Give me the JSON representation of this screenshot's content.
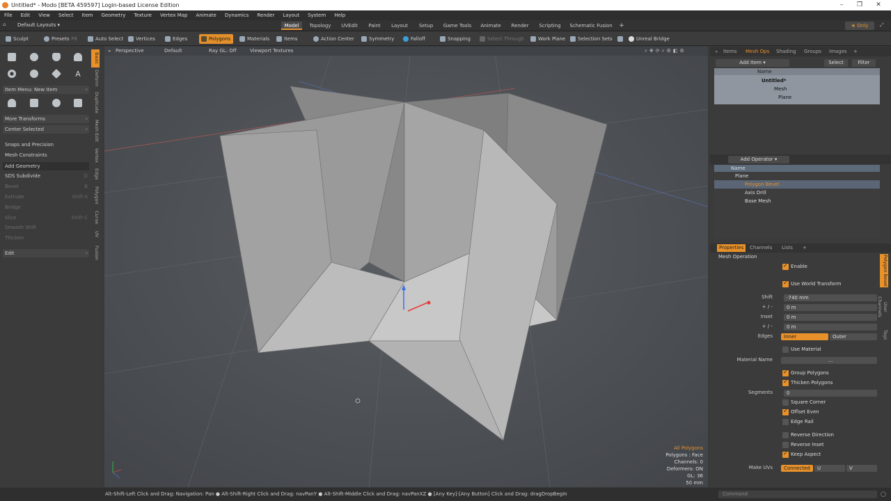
{
  "window": {
    "title": "Untitled* - Modo [BETA 459597] Login-based License Edition"
  },
  "menu": [
    "File",
    "Edit",
    "View",
    "Select",
    "Item",
    "Geometry",
    "Texture",
    "Vertex Map",
    "Animate",
    "Dynamics",
    "Render",
    "Layout",
    "System",
    "Help"
  ],
  "layout_bar": {
    "layout_name": "Default Layouts",
    "only_label": "Only",
    "tabs": [
      "Model",
      "Topology",
      "UVEdit",
      "Paint",
      "Layout",
      "Setup",
      "Game Tools",
      "Animate",
      "Render",
      "Scripting",
      "Schematic Fusion"
    ],
    "add": "+"
  },
  "toolbar": {
    "sculpt": "Sculpt",
    "presets": "Presets",
    "presets_key": "F6",
    "auto_select": "Auto Select",
    "vertices": "Vertices",
    "edges": "Edges",
    "polygons": "Polygons",
    "materials": "Materials",
    "items": "Items",
    "action_center": "Action Center",
    "symmetry": "Symmetry",
    "falloff": "Falloff",
    "snapping": "Snapping",
    "select_through": "Select Through",
    "work_plane": "Work Plane",
    "selection_sets": "Selection Sets",
    "unreal_bridge": "Unreal Bridge"
  },
  "left_panel": {
    "item_menu": "Item Menu: New Item",
    "more_transforms": "More Transforms",
    "center_selected": "Center Selected",
    "snaps": "Snaps and Precision",
    "mesh_constraints": "Mesh Constraints",
    "add_geometry": "Add Geometry",
    "tools": [
      {
        "label": "SDS Subdivide",
        "key": "D"
      },
      {
        "label": "Bevel",
        "key": "B"
      },
      {
        "label": "Extrude",
        "key": "Shift-X"
      },
      {
        "label": "Bridge",
        "key": ""
      },
      {
        "label": "Slice",
        "key": "Shift-C"
      },
      {
        "label": "Smooth Shift",
        "key": ""
      },
      {
        "label": "Thicken",
        "key": ""
      }
    ],
    "edit": "Edit",
    "vtabs": [
      "Basic",
      "Deform",
      "Duplicate",
      "Mesh Edit",
      "Vertex",
      "Edge",
      "Polygon",
      "Curve",
      "UV",
      "Fusion"
    ]
  },
  "viewport": {
    "perspective": "Perspective",
    "shading": "Default",
    "raygl": "Ray GL: Off",
    "textures": "Viewport Textures",
    "info": [
      "All Polygons",
      "Polygons : Face",
      "Channels: 0",
      "Deformers: ON",
      "GL: 36",
      "50 mm"
    ]
  },
  "status_bar": "Alt-Shift-Left Click and Drag: Navigation: Pan ● Alt-Shift-Right Click and Drag: navPanY ● Alt-Shift-Middle Click and Drag: navPanXZ ● [Any Key]-[Any Button] Click and Drag: dragDropBegin",
  "right_panel": {
    "tabs": [
      "Items",
      "Mesh Ops",
      "Shading",
      "Groups",
      "Images"
    ],
    "add_item": "Add Item",
    "select": "Select",
    "filter": "Filter",
    "name_col": "Name",
    "tree": [
      "Untitled*",
      "Mesh",
      "Plane"
    ],
    "add_operator": "Add Operator",
    "ops": [
      "Plane",
      "Polygon Bevel",
      "Axis Drill",
      "Base Mesh"
    ],
    "prop_tabs": [
      "Properties",
      "Channels",
      "Lists"
    ],
    "side_tabs": [
      "Polygon Bevel",
      "User Channels",
      "Tags"
    ],
    "section": "Mesh Operation",
    "enable": "Enable",
    "use_world": "Use World Transform",
    "shift_label": "Shift",
    "shift": "-740 mm",
    "pm_label": "+ / -",
    "pm1": "0 m",
    "inset_label": "Inset",
    "inset": "0 m",
    "pm2": "0 m",
    "edges_label": "Edges",
    "inner": "Inner",
    "outer": "Outer",
    "use_material": "Use Material",
    "material_name_label": "Material Name",
    "material_name": "...",
    "group_polygons": "Group Polygons",
    "thicken_polygons": "Thicken Polygons",
    "segments_label": "Segments",
    "segments": "0",
    "square_corner": "Square Corner",
    "offset_even": "Offset Even",
    "edge_rail": "Edge Rail",
    "reverse_direction": "Reverse Direction",
    "reverse_inset": "Reverse Inset",
    "keep_aspect": "Keep Aspect",
    "make_uvs_label": "Make UVs",
    "connected": "Connected",
    "u": "U",
    "v": "V",
    "command": "Command"
  }
}
